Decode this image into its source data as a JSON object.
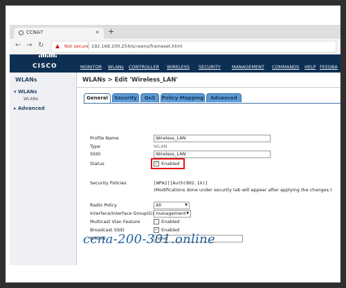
{
  "browser": {
    "tab_title": "CCNA7",
    "tab_close": "×",
    "new_tab": "+",
    "not_secure": "Not secure",
    "url": "192.168.200.254/screens/frameset.html"
  },
  "header": {
    "logo": "CISCO",
    "menu": [
      "MONITOR",
      "WLANs",
      "CONTROLLER",
      "WIRELESS",
      "SECURITY",
      "MANAGEMENT",
      "COMMANDS",
      "HELP",
      "FEEDBA"
    ]
  },
  "sidebar": {
    "title": "WLANs",
    "items": [
      {
        "label": "WLANs",
        "arrow": "▾"
      },
      {
        "label": "WLANs"
      },
      {
        "label": "Advanced",
        "arrow": "▸"
      }
    ]
  },
  "main": {
    "breadcrumb": "WLANs > Edit  'Wireless_LAN'",
    "tabs": [
      "General",
      "Security",
      "QoS",
      "Policy-Mapping",
      "Advanced"
    ],
    "active_tab": "General",
    "fields": {
      "profile_name_label": "Profile Name",
      "profile_name_value": "Wireless_LAN",
      "type_label": "Type",
      "type_value": "WLAN",
      "ssid_label": "SSID",
      "ssid_value": "Wireless_LAN",
      "status_label": "Status",
      "status_checkbox": "✓",
      "status_value": "Enabled",
      "security_policies_label": "Security Policies",
      "security_policies_value": "[WPA2][Auth(802.1X)]",
      "security_note": "(Modifications done under security tab will appear after applying the changes.)",
      "radio_policy_label": "Radio Policy",
      "radio_policy_value": "All",
      "interface_label": "Interface/Interface Group(G)",
      "interface_value": "management",
      "multicast_label": "Multicast Vlan Feature",
      "multicast_value": "Enabled",
      "broadcast_label": "Broadcast SSID",
      "broadcast_checkbox": "✓",
      "broadcast_value": "Enabled",
      "nas_id_label": "NAS-ID",
      "nas_id_value": "none"
    }
  },
  "watermark": "ccna-200-301.online"
}
